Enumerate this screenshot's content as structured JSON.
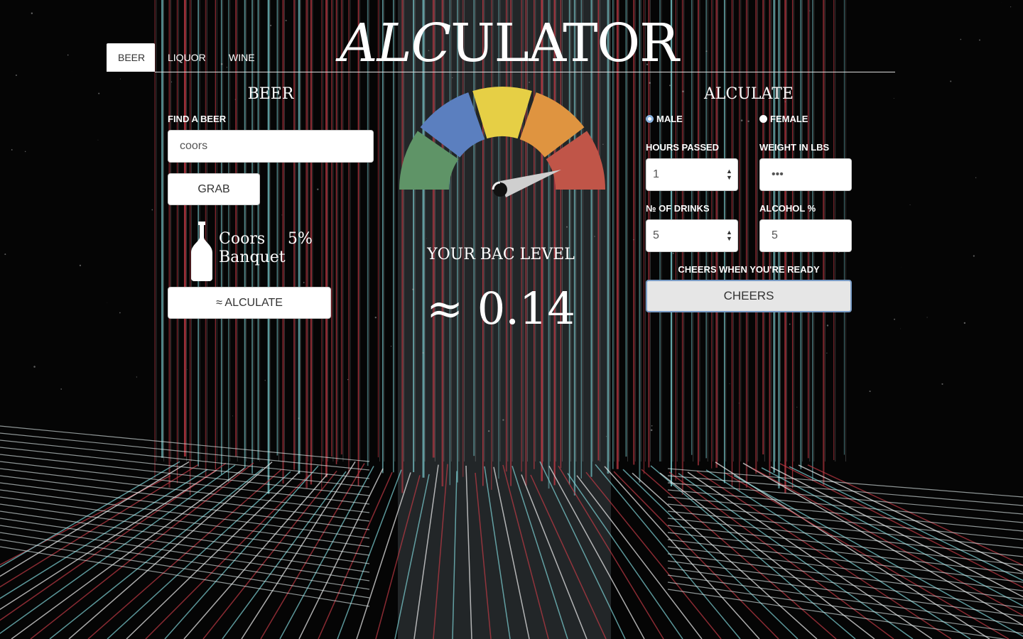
{
  "app": {
    "title_italic": "ALC",
    "title_rest": "ULATOR"
  },
  "tabs": [
    {
      "label": "BEER",
      "active": true
    },
    {
      "label": "LIQUOR",
      "active": false
    },
    {
      "label": "WINE",
      "active": false
    }
  ],
  "beer_panel": {
    "title": "BEER",
    "find_label": "FIND A BEER",
    "search_value": "coors",
    "grab_label": "GRAB",
    "result": {
      "name_line1": "Coors",
      "name_line2": "Banquet",
      "abv": "5%",
      "icon": "beer-bottle-icon"
    },
    "alculate_label": "≈ ALCULATE"
  },
  "gauge": {
    "segments": [
      "#5f9467",
      "#5b7fbf",
      "#e6cf45",
      "#df9440",
      "#c05548"
    ],
    "bac_label": "YOUR BAC LEVEL",
    "bac_value": "≈ 0.14"
  },
  "alculate_panel": {
    "title": "ALCULATE",
    "gender_options": [
      {
        "label": "MALE",
        "checked": true
      },
      {
        "label": "FEMALE",
        "checked": false
      }
    ],
    "hours_label": "HOURS PASSED",
    "hours_value": "1",
    "weight_label": "WEIGHT IN LBS",
    "weight_value": "•••",
    "drinks_label": "№ of DRINKS",
    "drinks_value": "5",
    "alcohol_label": "ALCOHOL %",
    "alcohol_value": "5",
    "ready_label": "CHEERS WHEN YOU'RE READY",
    "cheers_label": "CHEERS"
  }
}
